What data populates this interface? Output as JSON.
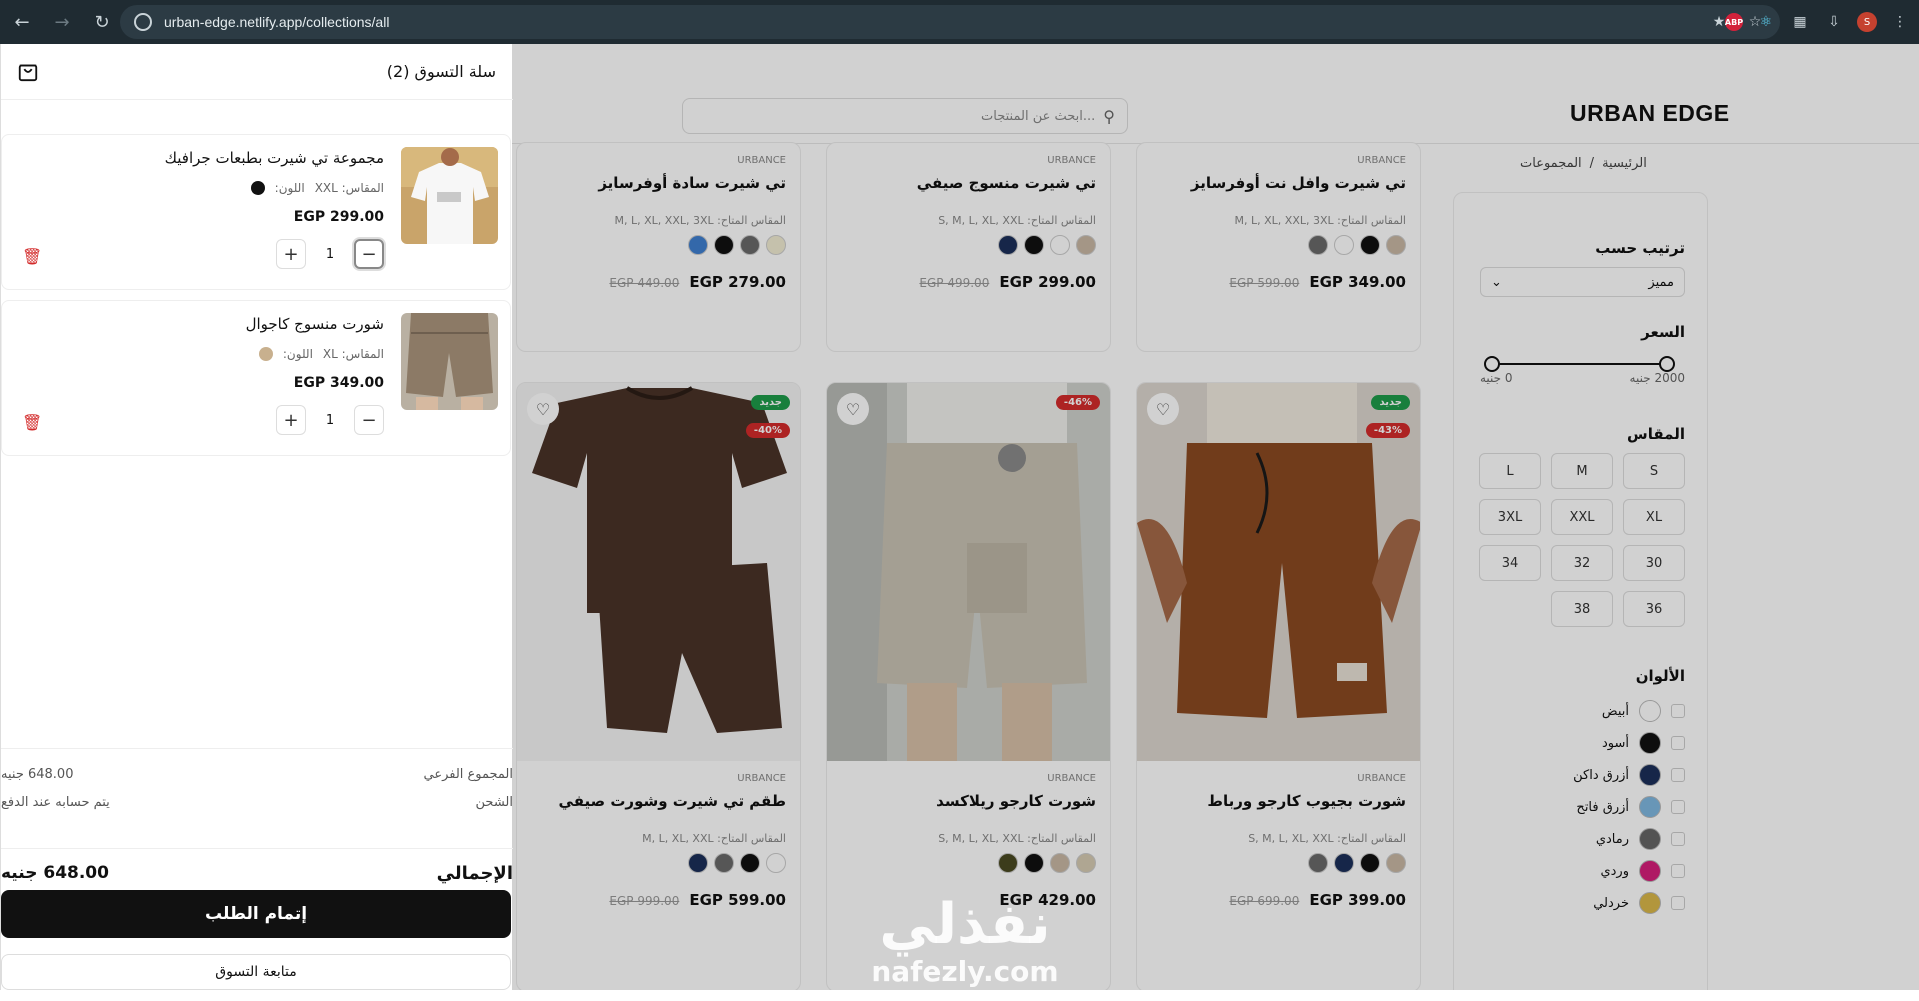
{
  "browser": {
    "url": "urban-edge.netlify.app/collections/all",
    "profile_initial": "S"
  },
  "header": {
    "logo": "URBAN EDGE",
    "search_placeholder": "ابحث عن المنتجات...",
    "breadcrumb_home": "الرئيسية",
    "breadcrumb_sep": "/",
    "breadcrumb_current": "المجموعات"
  },
  "filters": {
    "sort_title": "ترتيب حسب",
    "sort_value": "مميز",
    "price_title": "السعر",
    "price_min": "0 جنيه",
    "price_max": "2000 جنيه",
    "price_range_fraction": [
      0,
      1
    ],
    "size_title": "المقاس",
    "sizes": [
      "S",
      "M",
      "L",
      "XL",
      "XXL",
      "3XL",
      "30",
      "32",
      "34",
      "36",
      "38"
    ],
    "colors_title": "الألوان",
    "colors": [
      {
        "name": "أبيض",
        "hex": "#ffffff"
      },
      {
        "name": "أسود",
        "hex": "#111111"
      },
      {
        "name": "أزرق داكن",
        "hex": "#1b2f5a"
      },
      {
        "name": "أزرق فاتح",
        "hex": "#7fb7e0"
      },
      {
        "name": "رمادي",
        "hex": "#666666"
      },
      {
        "name": "وردي",
        "hex": "#d61f7b"
      },
      {
        "name": "خردلي",
        "hex": "#d9b84a"
      }
    ]
  },
  "products_top": [
    {
      "brand": "URBANCE",
      "name": "تي شيرت وافل نت أوفرسايز",
      "sizes": "المقاس المتاح: M, L, XL, XXL, 3XL",
      "swatches": [
        "#c8b8a4",
        "#111111",
        "#ffffff",
        "#6a6a6a"
      ],
      "price": "EGP 349.00",
      "was": "EGP 599.00"
    },
    {
      "brand": "URBANCE",
      "name": "تي شيرت منسوج صيفي",
      "sizes": "المقاس المتاح: S, M, L, XL, XXL",
      "swatches": [
        "#c8b8a4",
        "#ffffff",
        "#111111",
        "#1b2f5a"
      ],
      "price": "EGP 299.00",
      "was": "EGP 499.00"
    },
    {
      "brand": "URBANCE",
      "name": "تي شيرت سادة أوفرسايز",
      "sizes": "المقاس المتاح: M, L, XL, XXL, 3XL",
      "swatches": [
        "#f1ecd2",
        "#6a6a6a",
        "#111111",
        "#3f7fd0"
      ],
      "price": "EGP 279.00",
      "was": "EGP 449.00"
    }
  ],
  "products_bottom": [
    {
      "brand": "URBANCE",
      "name": "شورت بجيوب كارجو ورباط",
      "sizes": "المقاس المتاح: S, M, L, XL, XXL",
      "swatches": [
        "#c8b8a4",
        "#111111",
        "#1b2f5a",
        "#6a6a6a"
      ],
      "price": "EGP 399.00",
      "was": "EGP 699.00",
      "badge_new": "جديد",
      "badge_off": "43%-"
    },
    {
      "brand": "URBANCE",
      "name": "شورت كارجو ريلاكسد",
      "sizes": "المقاس المتاح: S, M, L, XL, XXL",
      "swatches": [
        "#d6cbb3",
        "#c8b8a4",
        "#111111",
        "#4a4a22"
      ],
      "price": "EGP 429.00",
      "was": "",
      "badge_new": "",
      "badge_off": "46%-"
    },
    {
      "brand": "URBANCE",
      "name": "طقم تي شيرت وشورت صيفي",
      "sizes": "المقاس المتاح: M, L, XL, XXL",
      "swatches": [
        "#ffffff",
        "#111111",
        "#6a6a6a",
        "#1b2f5a"
      ],
      "price": "EGP 599.00",
      "was": "EGP 999.00",
      "badge_new": "جديد",
      "badge_off": "40%-"
    }
  ],
  "cart": {
    "title": "سلة التسوق (2)",
    "items": [
      {
        "name": "مجموعة تي شيرت بطبعات جرافيك",
        "size_label": "المقاس: XXL",
        "color_label": "اللون:",
        "color_hex": "#111111",
        "price": "EGP 299.00",
        "qty": "1"
      },
      {
        "name": "شورت منسوج كاجوال",
        "size_label": "المقاس: XL",
        "color_label": "اللون:",
        "color_hex": "#c8b08e",
        "price": "EGP 349.00",
        "qty": "1"
      }
    ],
    "subtotal_label": "المجموع الفرعي",
    "subtotal_value": "648.00 جنيه",
    "shipping_label": "الشحن",
    "shipping_value": "يتم حسابه عند الدفع",
    "total_label": "الإجمالي",
    "total_value": "648.00 جنيه",
    "checkout_label": "إتمام الطلب",
    "continue_label": "متابعة التسوق"
  },
  "watermark": {
    "arabic": "نفذلي",
    "latin": "nafezly.com"
  }
}
